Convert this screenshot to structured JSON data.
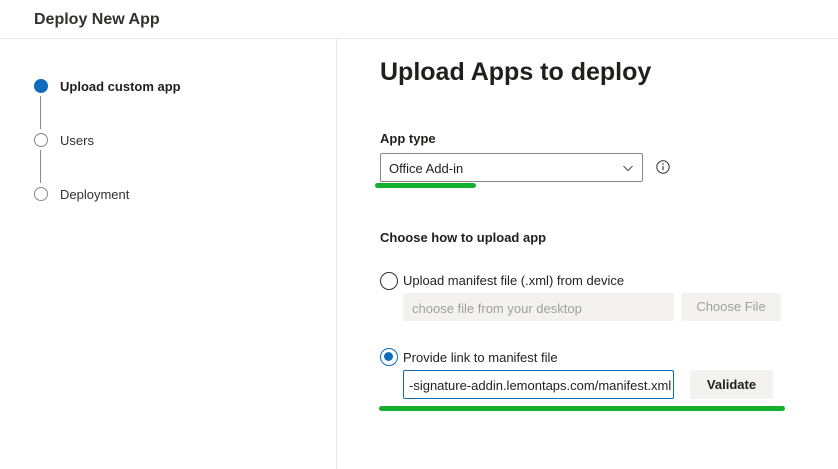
{
  "header": {
    "title": "Deploy New App"
  },
  "steps": [
    {
      "label": "Upload custom app",
      "state": "active"
    },
    {
      "label": "Users",
      "state": "pending"
    },
    {
      "label": "Deployment",
      "state": "pending"
    }
  ],
  "main": {
    "title": "Upload Apps to deploy",
    "app_type": {
      "label": "App type",
      "selected": "Office Add-in",
      "info_icon": "info-icon"
    },
    "upload_section": {
      "label": "Choose how to upload app",
      "option_file": {
        "label": "Upload manifest file (.xml) from device",
        "checked": false,
        "placeholder": "choose file from your desktop",
        "button_label": "Choose File"
      },
      "option_link": {
        "label": "Provide link to manifest file",
        "checked": true,
        "value": "-signature-addin.lemontaps.com/manifest.xml",
        "button_label": "Validate"
      }
    }
  },
  "colors": {
    "accent": "#0f6cbd",
    "annotation": "#12b02e"
  }
}
